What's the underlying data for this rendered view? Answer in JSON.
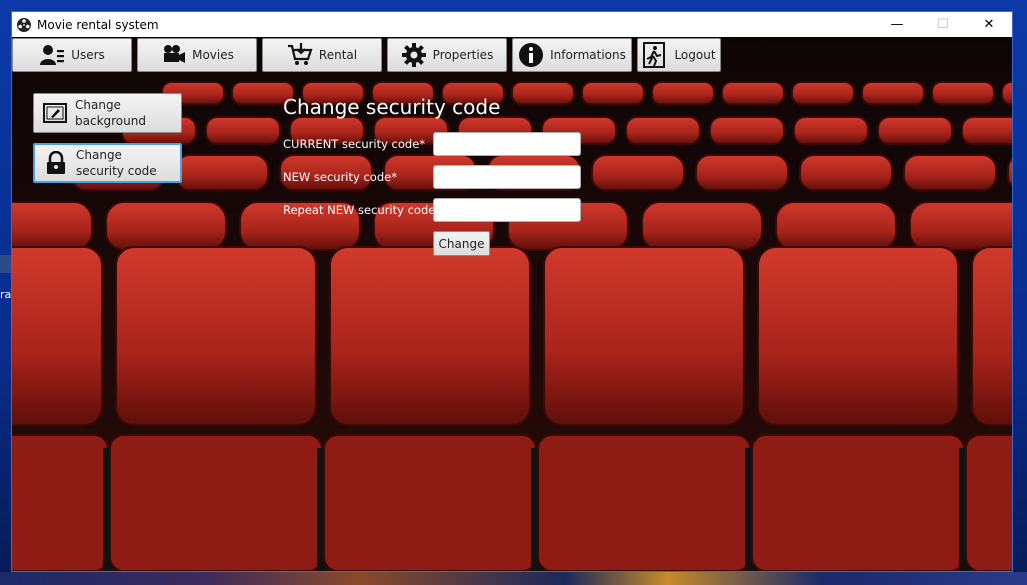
{
  "window": {
    "title": "Movie rental system",
    "controls": {
      "minimize": "—",
      "maximize": "☐",
      "close": "✕"
    }
  },
  "desktop": {
    "edge_text": "ra"
  },
  "toolbar": {
    "users": "Users",
    "movies": "Movies",
    "rental": "Rental",
    "properties": "Properties",
    "informations": "Informations",
    "logout": "Logout"
  },
  "sidebar": {
    "change_background": [
      "Change",
      "background"
    ],
    "change_security_code": [
      "Change",
      "security code"
    ]
  },
  "form": {
    "title": "Change security code",
    "current_label": "CURRENT security code*",
    "new_label": "NEW security code*",
    "repeat_label": "Repeat NEW security code*",
    "current_value": "",
    "new_value": "",
    "repeat_value": "",
    "submit_label": "Change"
  },
  "colors": {
    "seat_red": "#b8281f",
    "active_border": "#4aa3e0",
    "window_border": "#3a6ad0"
  },
  "icons": {
    "app": "film-reel-icon",
    "users": "users-icon",
    "movies": "movie-camera-icon",
    "rental": "shopping-cart-icon",
    "properties": "gear-icon",
    "informations": "info-icon",
    "logout": "exit-icon",
    "background": "picture-icon",
    "security": "lock-icon"
  }
}
